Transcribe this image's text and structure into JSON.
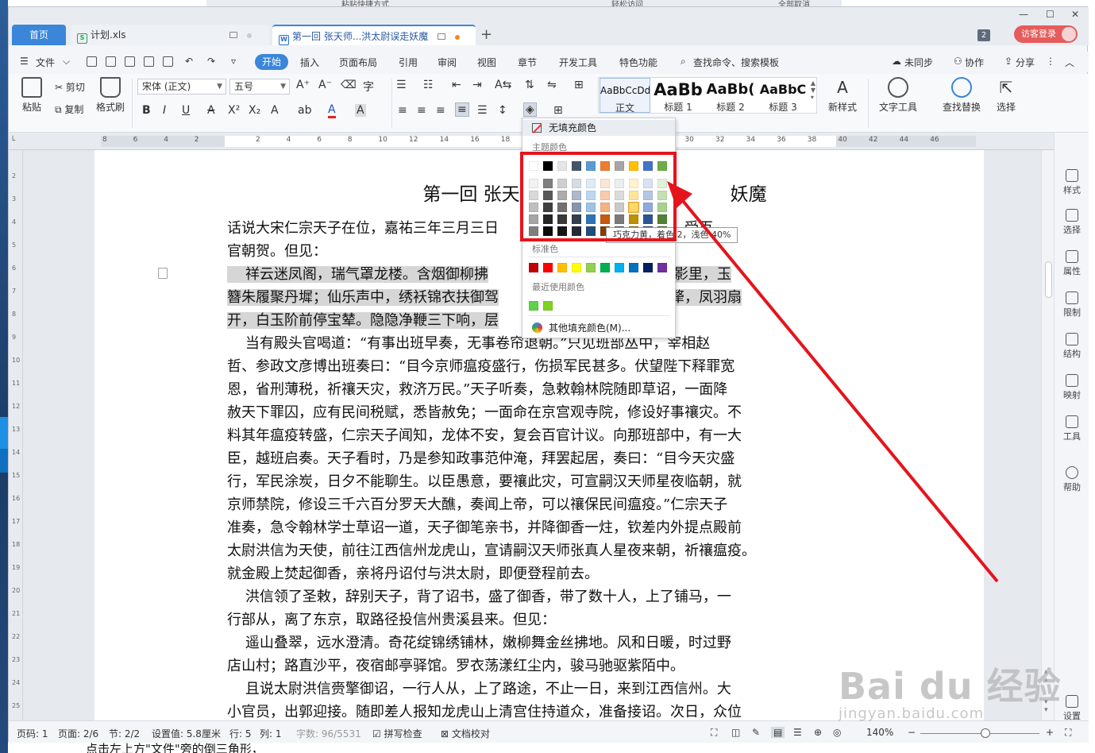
{
  "background_app": {
    "items": [
      "粘贴快捷方式",
      "轻松访问",
      "全部取消"
    ]
  },
  "tabs": {
    "home": "首页",
    "items": [
      {
        "label": "计划.xls"
      },
      {
        "label": "第一回 张天师...洪太尉误走妖魔"
      }
    ],
    "add": "+",
    "badge": "2",
    "login": "访客登录"
  },
  "window_controls": [
    "—",
    "☐",
    "✕"
  ],
  "menu": {
    "file": "文件",
    "items": [
      "开始",
      "插入",
      "页面布局",
      "引用",
      "审阅",
      "视图",
      "章节",
      "开发工具",
      "特色功能"
    ],
    "search": "查找命令、搜索模板",
    "sync": "未同步",
    "collab": "协作",
    "share": "分享"
  },
  "ribbon": {
    "paste": "粘贴",
    "cut": "剪切",
    "copy": "复制",
    "format_painter": "格式刷",
    "font_name": "宋体 (正文)",
    "font_size": "五号",
    "styles": [
      {
        "preview": "AaBbCcDd",
        "name": "正文"
      },
      {
        "preview": "AaBb",
        "name": "标题 1"
      },
      {
        "preview": "AaBb(",
        "name": "标题 2"
      },
      {
        "preview": "AaBbC",
        "name": "标题 3"
      }
    ],
    "new_style": "新样式",
    "text_tools": "文字工具",
    "find_replace": "查找替换",
    "select": "选择"
  },
  "ruler": {
    "h_numbers": [
      "8",
      "6",
      "4",
      "2",
      "",
      "2",
      "4",
      "6",
      "8",
      "10",
      "12",
      "14",
      "16",
      "18",
      "",
      "",
      "",
      "",
      "",
      "30",
      "32",
      "34",
      "36",
      "38",
      "40",
      "42",
      "44",
      "46"
    ],
    "v_numbers": [
      "2",
      "3",
      "4",
      "5",
      "6",
      "7",
      "8",
      "9",
      "10",
      "11",
      "12",
      "13",
      "14",
      "15",
      "16",
      "17",
      "18",
      "19",
      "20",
      "21",
      "22",
      "23",
      "24",
      "25"
    ]
  },
  "document": {
    "title": "第一回  张天师祈禳",
    "title_tail": "妖魔",
    "lines": [
      {
        "text": "话说大宋仁宗天子在位，嘉祐三年三月三日",
        "tail": "宫殿，受百",
        "hl": false
      },
      {
        "text": "官朝贺。但见：",
        "tail": "",
        "hl": false
      },
      {
        "text": "    祥云迷凤阁，瑞气罩龙楼。含烟御柳拂",
        "tail": "。天香影里，玉",
        "hl": true
      },
      {
        "text": "簪朱履聚丹墀；仙乐声中，绣袄锦衣扶御驾",
        "tail": "现金犛，凤羽扇",
        "hl": true
      },
      {
        "text": "开，白玉阶前停宝辇。隐隐净鞭三下响，层",
        "tail": "",
        "hl": true
      },
      {
        "text": "    当有殿头官喝道：“有事出班早奏，无事卷帘退朝。”只见班部丛中，宰相赵",
        "tail": "",
        "hl": false
      },
      {
        "text": "哲、参政文彦博出班奏曰：“目今京师瘟疫盛行，伤损军民甚多。伏望陛下释罪宽",
        "tail": "",
        "hl": false
      },
      {
        "text": "恩，省刑薄税，祈禳天灾，救济万民。”天子听奏，急敕翰林院随即草诏，一面降",
        "tail": "",
        "hl": false
      },
      {
        "text": "赦天下罪囚，应有民间税赋，悉皆赦免；一面命在京宫观寺院，修设好事禳灾。不",
        "tail": "",
        "hl": false
      },
      {
        "text": "料其年瘟疫转盛，仁宗天子闻知，龙体不安，复会百官计议。向那班部中，有一大",
        "tail": "",
        "hl": false
      },
      {
        "text": "臣，越班启奏。天子看时，乃是参知政事范仲淹，拜罢起居，奏曰：“目今天灾盛",
        "tail": "",
        "hl": false
      },
      {
        "text": "行，军民涂炭，日夕不能聊生。以臣愚意，要禳此灾，可宣嗣汉天师星夜临朝，就",
        "tail": "",
        "hl": false
      },
      {
        "text": "京师禁院，修设三千六百分罗天大醮，奏闻上帝，可以禳保民间瘟疫。”仁宗天子",
        "tail": "",
        "hl": false
      },
      {
        "text": "准奏，急令翰林学士草诏一道，天子御笔亲书，并降御香一炷，钦差内外提点殿前",
        "tail": "",
        "hl": false
      },
      {
        "text": "太尉洪信为天使，前往江西信州龙虎山，宣请嗣汉天师张真人星夜来朝，祈禳瘟疫。",
        "tail": "",
        "hl": false
      },
      {
        "text": "就金殿上焚起御香，亲将丹诏付与洪太尉，即便登程前去。",
        "tail": "",
        "hl": false
      },
      {
        "text": "    洪信领了圣敕，辞别天子，背了诏书，盛了御香，带了数十人，上了铺马，一",
        "tail": "",
        "hl": false
      },
      {
        "text": "行部从，离了东京，取路径投信州贵溪县来。但见：",
        "tail": "",
        "hl": false
      },
      {
        "text": "    遥山叠翠，远水澄清。奇花绽锦绣铺林，嫩柳舞金丝拂地。风和日暖，时过野",
        "tail": "",
        "hl": false
      },
      {
        "text": "店山村；路直沙平，夜宿邮亭驿馆。罗衣荡漾红尘内，骏马驰驱紫陌中。",
        "tail": "",
        "hl": false
      },
      {
        "text": "    且说太尉洪信赍擎御诏，一行人从，上了路途，不止一日，来到江西信州。大",
        "tail": "",
        "hl": false
      },
      {
        "text": "小官员，出郭迎接。随即差人报知龙虎山上清宫住持道众，准备接诏。次日，众位",
        "tail": "",
        "hl": false
      }
    ]
  },
  "right_panel": [
    "样式",
    "选择",
    "属性",
    "限制",
    "结构",
    "映射",
    "工具",
    "帮助",
    "设置"
  ],
  "status": {
    "page_num": "页码: 1",
    "pages": "页面: 2/6",
    "section": "节: 2/2",
    "setting": "设置值: 5.8厘米",
    "row": "行: 5",
    "col": "列: 1",
    "words": "字数: 96/5531",
    "spell": "拼写检查",
    "proof": "文档校对",
    "zoom": "140%"
  },
  "color_menu": {
    "no_fill": "无填充颜色",
    "theme_header": "主题颜色",
    "standard_header": "标准色",
    "recent_header": "最近使用颜色",
    "more": "其他填充颜色(M)...",
    "theme_top": [
      "#ffffff",
      "#000000",
      "#e7e6e6",
      "#44546a",
      "#5b9bd5",
      "#ed7d31",
      "#a5a5a5",
      "#ffc000",
      "#4472c4",
      "#70ad47"
    ],
    "theme_shades": [
      [
        "#f2f2f2",
        "#7f7f7f",
        "#d0cece",
        "#d6dce4",
        "#deebf6",
        "#fbe5d5",
        "#ededed",
        "#fff2cc",
        "#d9e2f3",
        "#e2efd9"
      ],
      [
        "#d8d8d8",
        "#595959",
        "#aeabab",
        "#adb9ca",
        "#bdd7ee",
        "#f7cbac",
        "#dbdbdb",
        "#fee599",
        "#b4c6e7",
        "#c5e0b3"
      ],
      [
        "#bfbfbf",
        "#3f3f3f",
        "#757070",
        "#8496b0",
        "#9dc3e6",
        "#f4b183",
        "#c9c9c9",
        "#ffd965",
        "#8eaadb",
        "#a8d08d"
      ],
      [
        "#a5a5a5",
        "#262626",
        "#3a3838",
        "#323f4f",
        "#2e75b5",
        "#c55a11",
        "#7b7b7b",
        "#bf9000",
        "#2f5496",
        "#538135"
      ],
      [
        "#7f7f7f",
        "#0c0c0c",
        "#171616",
        "#222a35",
        "#1e4e79",
        "#833c0b",
        "#525252",
        "#7f6000",
        "#1f3864",
        "#375623"
      ]
    ],
    "standard": [
      "#c00000",
      "#ff0000",
      "#ffc000",
      "#ffff00",
      "#92d050",
      "#00b050",
      "#00b0f0",
      "#0070c0",
      "#002060",
      "#7030a0"
    ],
    "recent": [
      "#5fd24a",
      "#7ed321"
    ],
    "tooltip": "巧克力黄，着色 2，浅色 40%"
  },
  "watermark": {
    "main": "Bai du 经验",
    "sub": "jingyan.baidu.com"
  },
  "footer_peek": "点击左上方\"文件\"旁的倒三角形，"
}
